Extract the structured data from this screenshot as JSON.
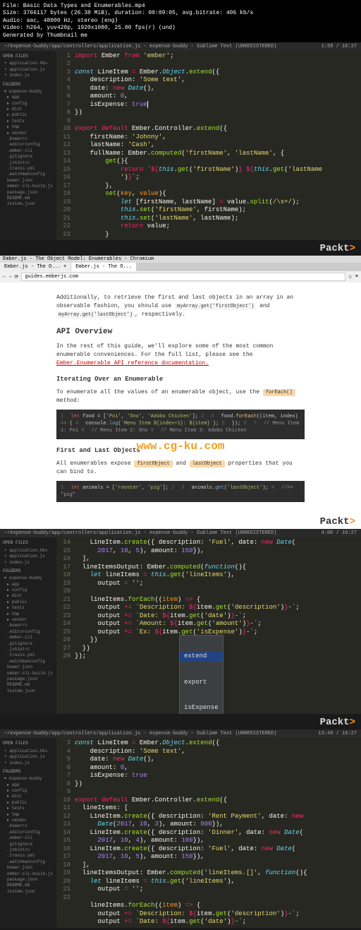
{
  "meta": {
    "file": "File: Basic Data Types and Enumerables.mp4",
    "size": "Size: 3766117 bytes (26.38 MiB), duration: 00:09:05, avg.bitrate: 406 kb/s",
    "audio": "Audio: aac, 48000 Hz, stereo (eng)",
    "video": "Video: h264, yuv420p, 1920x1080, 25.00 fps(r) (und)",
    "gen": "Generated by Thumbnail me"
  },
  "titlebar": {
    "path": "~/expense-buddy/app/controllers/application.js - expense-buddy - Sublime Text (UNREGISTERED)",
    "time1": "1:59 / 16:27",
    "time2": "4:06 / 16:27",
    "time3": "13:49 / 16:27"
  },
  "sidebar": {
    "open_files": "OPEN FILES",
    "files": [
      "application.hbs",
      "application.js",
      "index.js"
    ],
    "folders": "FOLDERS",
    "tree": [
      "expense-buddy",
      "app",
      "config",
      "dist",
      "public",
      "tests",
      "tmp",
      "vendor",
      ".bowerrc",
      ".editorconfig",
      ".ember-cli",
      ".gitignore",
      ".jshintrc",
      ".travis.yml",
      ".watchmanconfig",
      "bower.json",
      "ember-cli-build.js",
      "package.json",
      "README.md",
      "testem.json"
    ]
  },
  "code1": {
    "lines": [
      1,
      2,
      3,
      4,
      5,
      6,
      7,
      8,
      9,
      10,
      11,
      12,
      13,
      14,
      15,
      16,
      17,
      18,
      19,
      20,
      21,
      22,
      23
    ]
  },
  "browser": {
    "title": "Ember.js - The Object Model: Enumerables - Chromium",
    "tab1": "Ember.js - The O... ×",
    "tab2": "Ember.js - The O...",
    "url": "guides.emberjs.com",
    "text1": "Additionally, to retrieve the first and last objects in an array in an observable fashion, you should use",
    "code1": "myArray.get('firstObject')",
    "text2": "and",
    "code2": "myArray.get('lastObject')",
    "text3": ", respectively.",
    "h_api": "API Overview",
    "p_api": "In the rest of this guide, we'll explore some of the most common enumerable conveniences. For the full list, please see the",
    "link": "Ember.Enumerable API reference documentation.",
    "h_iter": "Iterating Over an Enumerable",
    "p_iter": "To enumerate all the values of an enumerable object, use the",
    "badge": "forEach()",
    "p_iter2": "method:",
    "h_flo": "First and Last Objects",
    "p_flo": "All enumerables expose",
    "badge_fo": "firstObject",
    "badge_lo": "lastObject",
    "p_flo2": "properties that you can bind to."
  },
  "autocomplete": {
    "opt1": "extend",
    "opt2": "export",
    "opt3": "isExpense"
  },
  "watermark": {
    "packt": "Packt",
    "cg": "www.cg-ku.com"
  }
}
